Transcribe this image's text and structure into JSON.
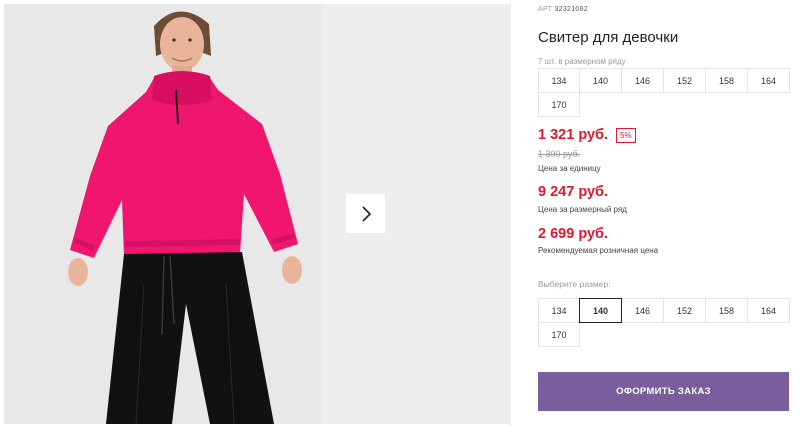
{
  "product": {
    "sku_prefix": "АРТ",
    "sku": "32321082",
    "title": "Свитер для девочки",
    "pack_label": "7 шт. в размерном ряду",
    "pack_sizes": [
      "134",
      "140",
      "146",
      "152",
      "158",
      "164",
      "170"
    ]
  },
  "pricing": {
    "unit_price": "1 321 руб.",
    "discount": "5%",
    "old_price": "1 390 руб.",
    "unit_caption": "Цена за единицу",
    "pack_price": "9 247 руб.",
    "pack_caption": "Цена за размерный ряд",
    "retail_price": "2 699 руб.",
    "retail_caption": "Рекомендуемая розничная цена"
  },
  "size_selector": {
    "label": "Выберите размер:",
    "sizes": [
      "134",
      "140",
      "146",
      "152",
      "158",
      "164",
      "170"
    ],
    "selected": "140"
  },
  "actions": {
    "order_label": "ОФОРМИТЬ ЗАКАЗ"
  },
  "colors": {
    "price_red": "#e0182d",
    "button_purple": "#7a5d9c",
    "sweater_pink": "#f0166e"
  },
  "icons": {
    "next": "chevron-right-icon"
  }
}
